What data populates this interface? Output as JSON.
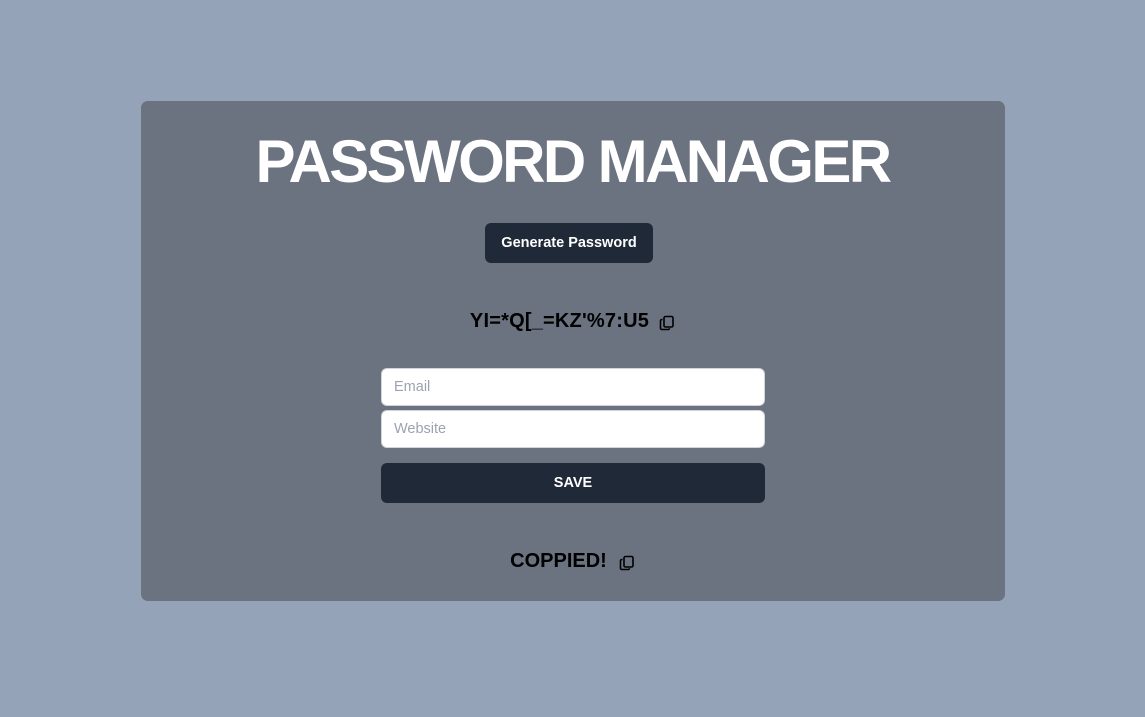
{
  "app": {
    "title": "PASSWORD MANAGER"
  },
  "generator": {
    "button_label": "Generate Password",
    "password": "YI=*Q[_=KZ'%7:U5",
    "copy_icon": "copy-icon"
  },
  "form": {
    "email_placeholder": "Email",
    "email_value": "",
    "website_placeholder": "Website",
    "website_value": "",
    "save_label": "SAVE"
  },
  "status": {
    "message": "COPPIED!",
    "copy_icon": "copy-icon"
  },
  "colors": {
    "page_background": "#94a3b8",
    "card_background": "#6b7280",
    "button_background": "#1f2937",
    "title_text": "#ffffff"
  }
}
